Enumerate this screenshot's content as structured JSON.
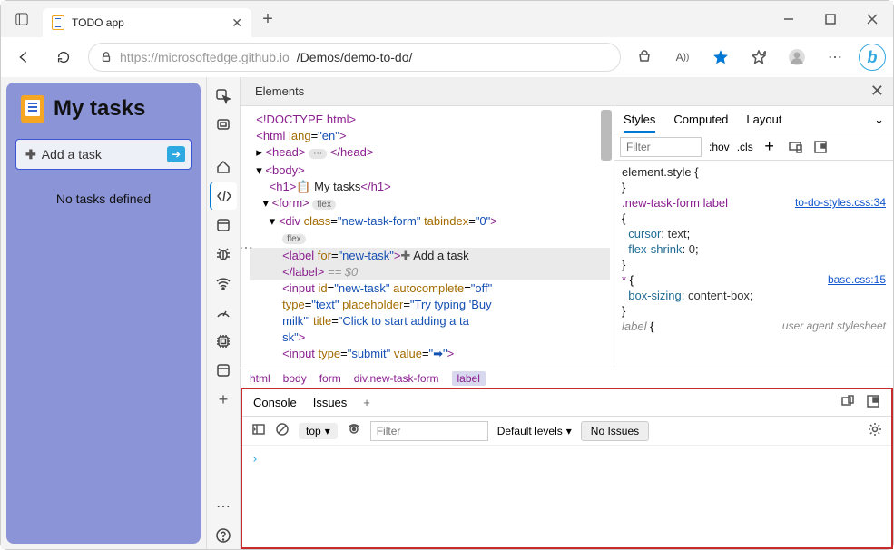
{
  "window": {
    "tab_title": "TODO app"
  },
  "addr": {
    "host": "https://microsoftedge.github.io",
    "path": "/Demos/demo-to-do/"
  },
  "app": {
    "title": "My tasks",
    "add_placeholder": "Add a task",
    "no_tasks": "No tasks defined"
  },
  "devtools": {
    "tab": "Elements",
    "dom": {
      "l1": "<!DOCTYPE html>",
      "l2": "<html lang=\"en\">",
      "l3_open": "<head>",
      "l3_close": "</head>",
      "l4": "<body>",
      "l5_open": "<h1>",
      "l5_text": " My tasks",
      "l5_close": "</h1>",
      "l6": "<form>",
      "l7": "<div class=\"new-task-form\" tabindex=\"0\">",
      "l8_open": "<label for=\"new-task\">",
      "l8_text": " Add a task",
      "l9": "</label>",
      "l9_gray": " == $0",
      "l10a": "<input id=\"new-task\" autocomplete=\"off\"",
      "l10b": "type=\"text\" placeholder=\"Try typing 'Buy",
      "l10c": "milk'\" title=\"Click to start adding a ta",
      "l10d": "sk\">",
      "l11": "<input type=\"submit\" value=\"➡\">",
      "flex_badge": "flex"
    },
    "crumbs": [
      "html",
      "body",
      "form",
      "div.new-task-form",
      "label"
    ],
    "styles": {
      "tabs": [
        "Styles",
        "Computed",
        "Layout"
      ],
      "filter_placeholder": "Filter",
      "hov": ":hov",
      "cls": ".cls",
      "r1": "element.style {",
      "r2_sel": ".new-task-form label",
      "r2_src": "to-do-styles.css:34",
      "r2_p1": "cursor",
      "r2_v1": "text",
      "r2_p2": "flex-shrink",
      "r2_v2": "0",
      "r3_sel": "*",
      "r3_src": "base.css:15",
      "r3_p1": "box-sizing",
      "r3_v1": "content-box",
      "r4_sel": "label",
      "r4_src": "user agent stylesheet"
    }
  },
  "drawer": {
    "tabs": [
      "Console",
      "Issues"
    ],
    "context": "top",
    "filter_placeholder": "Filter",
    "levels": "Default levels",
    "no_issues": "No Issues"
  }
}
